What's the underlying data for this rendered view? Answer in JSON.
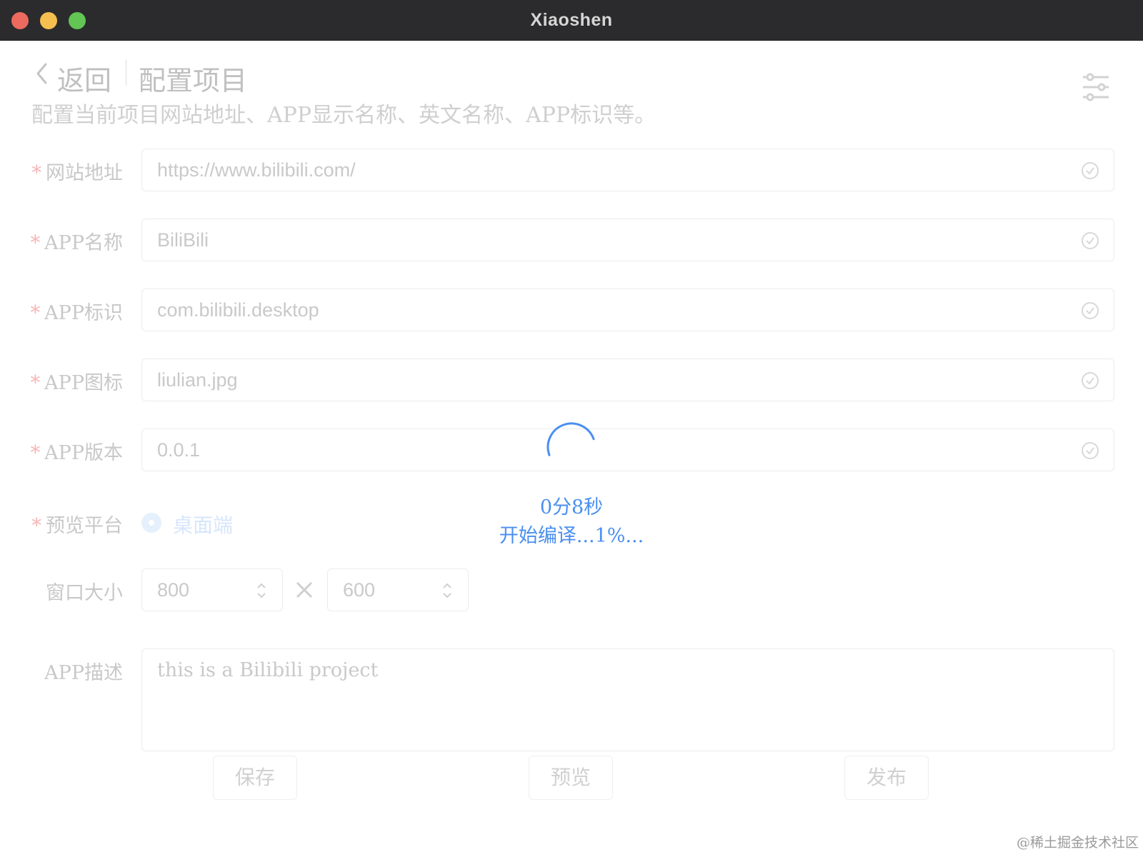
{
  "window": {
    "title": "Xiaoshen",
    "controls": [
      "close-button",
      "minimize-button",
      "maximize-button"
    ]
  },
  "header": {
    "back_label": "返回",
    "title": "配置项目",
    "subtitle": "配置当前项目网站地址、APP显示名称、英文名称、APP标识等。",
    "icons": [
      "back-chevron-icon",
      "settings-sliders-icon"
    ]
  },
  "form": {
    "required_mark": "*",
    "website": {
      "label": "网站地址",
      "value": "https://www.bilibili.com/"
    },
    "app_name": {
      "label": "APP名称",
      "value": "BiliBili"
    },
    "app_id": {
      "label": "APP标识",
      "value": "com.bilibili.desktop"
    },
    "app_icon": {
      "label": "APP图标",
      "value": "liulian.jpg"
    },
    "app_version": {
      "label": "APP版本",
      "value": "0.0.1"
    },
    "platform": {
      "label": "预览平台",
      "option": "桌面端",
      "selected": true
    },
    "window_size": {
      "label": "窗口大小",
      "width": "800",
      "height": "600",
      "separator_icon": "times-icon"
    },
    "description": {
      "label": "APP描述",
      "value": "this is a Bilibili project"
    }
  },
  "buttons": {
    "save": "保存",
    "preview": "预览",
    "publish": "发布"
  },
  "loading": {
    "elapsed": "0分8秒",
    "message": "开始编译...1%...",
    "icon": "spinner-icon",
    "color": "#4a8ff0"
  },
  "watermark": "@稀土掘金技术社区",
  "colors": {
    "titlebar": "#2b2b2d",
    "close": "#ed6a5e",
    "minimize": "#f5bf4f",
    "maximize": "#62c554",
    "accent": "#4a8ff0",
    "required": "#f6b4b4"
  }
}
